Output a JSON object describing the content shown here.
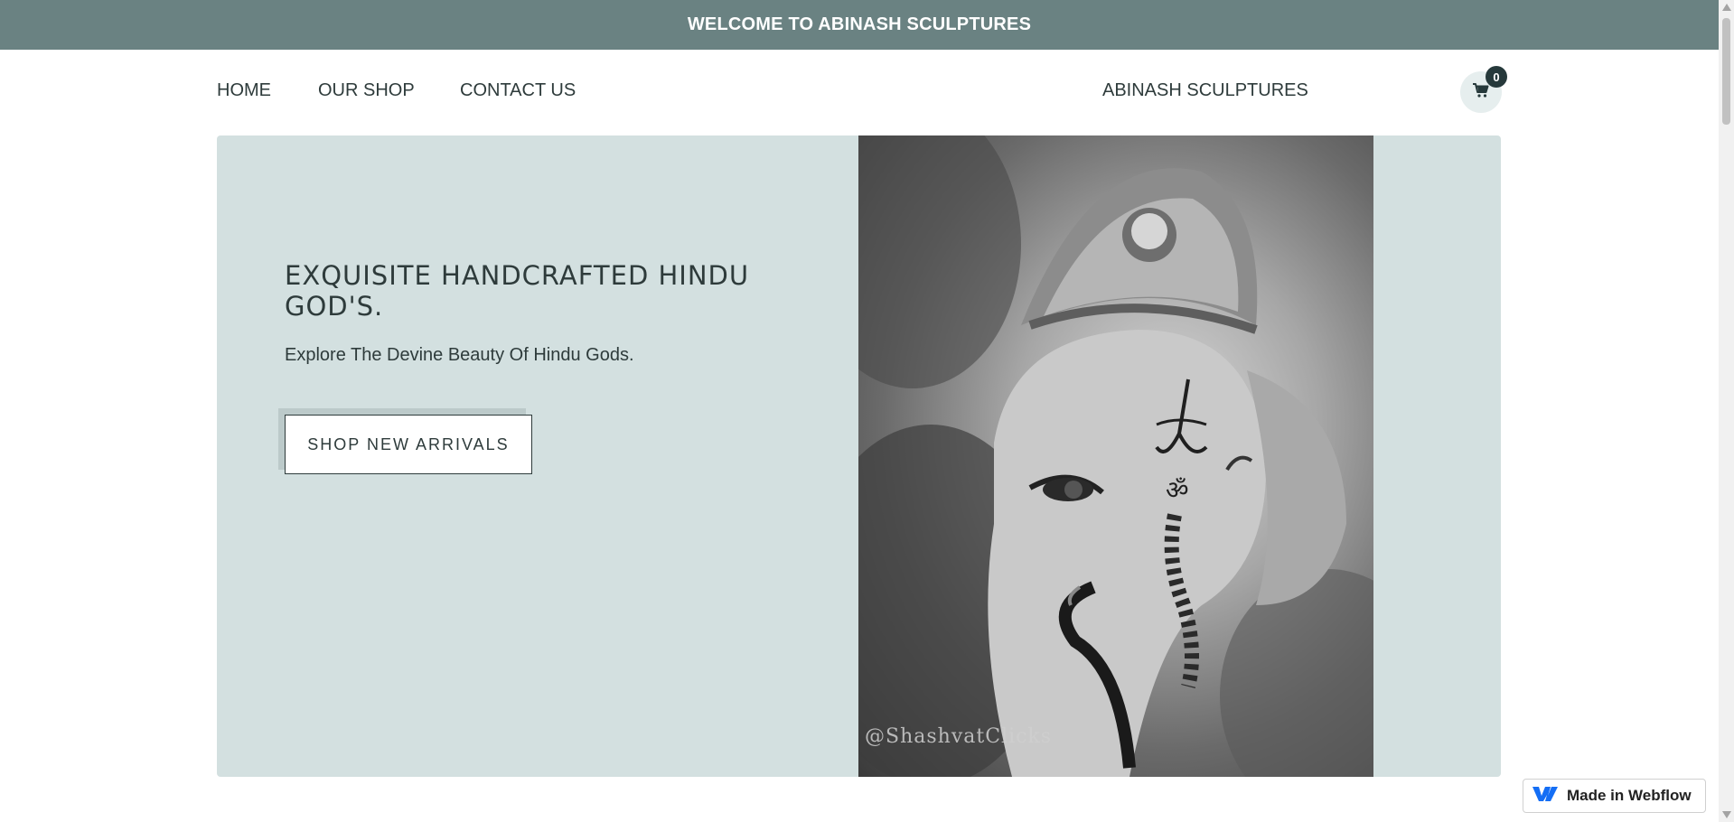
{
  "announcement": {
    "text": "WELCOME TO ABINASH SCULPTURES"
  },
  "nav": {
    "links": [
      {
        "label": "HOME"
      },
      {
        "label": "OUR SHOP"
      },
      {
        "label": "CONTACT US"
      }
    ],
    "brand": "ABINASH SCULPTURES",
    "cart": {
      "count": "0",
      "icon": "cart-icon"
    }
  },
  "hero": {
    "title": "EXQUISITE HANDCRAFTED HINDU GOD'S.",
    "subtitle": "Explore The Devine Beauty Of Hindu Gods.",
    "button_label": "SHOP NEW ARRIVALS",
    "image_watermark": "@ShashvatClicks"
  },
  "badge": {
    "label": "Made in Webflow",
    "icon": "webflow-logo-icon"
  },
  "colors": {
    "topbar": "#6a8282",
    "hero_bg": "#d3e0e0",
    "text": "#2e3b3b",
    "cart_badge": "#26393b"
  }
}
